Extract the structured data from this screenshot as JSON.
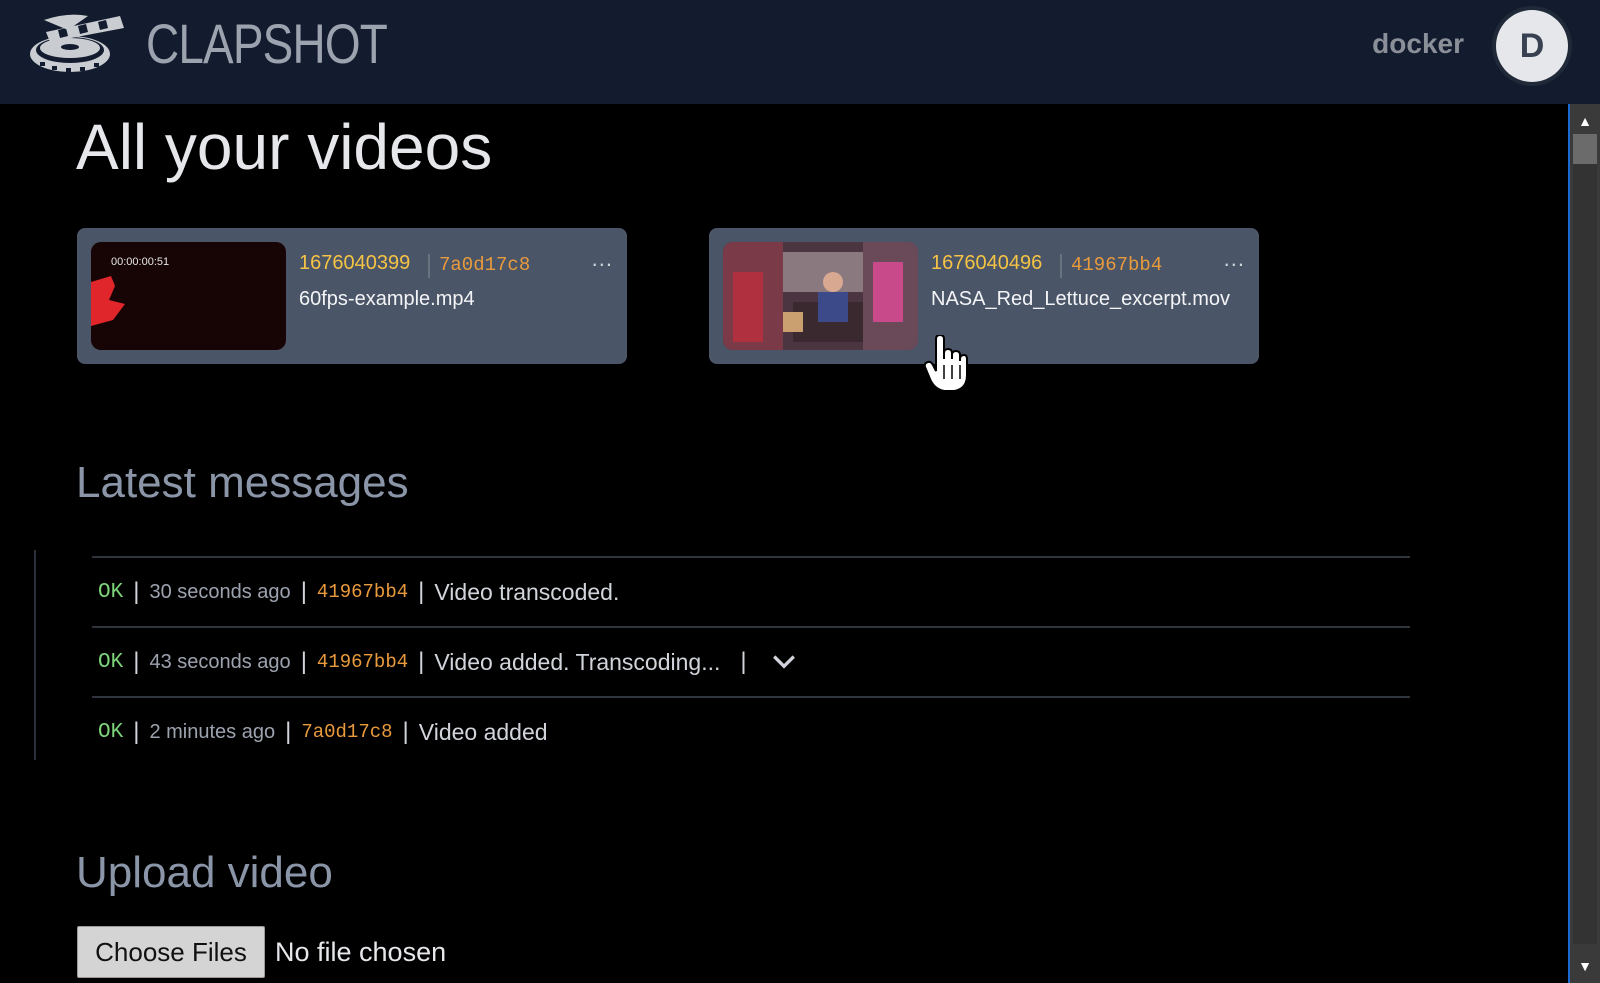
{
  "header": {
    "app_name": "CLAPSHOT",
    "username": "docker",
    "avatar_initial": "D"
  },
  "main": {
    "title": "All your videos",
    "videos": [
      {
        "timestamp": "1676040399",
        "hash": "7a0d17c8",
        "filename": "60fps-example.mp4",
        "thumb_time": "00:00:00:51",
        "menu": "..."
      },
      {
        "timestamp": "1676040496",
        "hash": "41967bb4",
        "filename": "NASA_Red_Lettuce_excerpt.mov",
        "menu": "..."
      }
    ]
  },
  "messages": {
    "title": "Latest messages",
    "items": [
      {
        "status": "OK",
        "time": "30 seconds ago",
        "hash": "41967bb4",
        "text": "Video transcoded."
      },
      {
        "status": "OK",
        "time": "43 seconds ago",
        "hash": "41967bb4",
        "text": "Video added. Transcoding..."
      },
      {
        "status": "OK",
        "time": "2 minutes ago",
        "hash": "7a0d17c8",
        "text": "Video added"
      }
    ]
  },
  "upload": {
    "title": "Upload video",
    "button_label": "Choose Files",
    "status": "No file chosen"
  },
  "colors": {
    "header_bg": "#131c2e",
    "card_bg": "#4a5568",
    "accent_yellow": "#f6c344",
    "accent_orange": "#e89a3c",
    "ok_green": "#7dd37a"
  }
}
